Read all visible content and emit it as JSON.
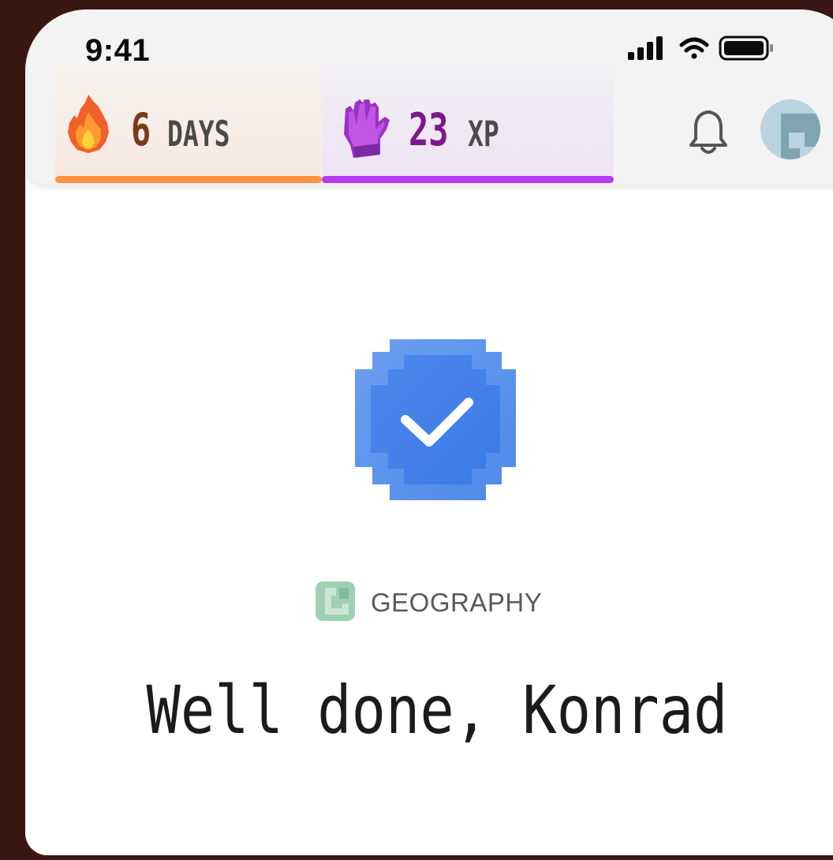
{
  "status_bar": {
    "time": "9:41",
    "icons": [
      "signal-icon",
      "wifi-icon",
      "battery-icon"
    ]
  },
  "header": {
    "streak": {
      "value": "6",
      "unit": "DAYS",
      "icon": "flame-icon",
      "color": "#ff9141"
    },
    "xp": {
      "value": "23",
      "unit": "XP",
      "icon": "glove-icon",
      "color": "#b53cf0"
    },
    "notifications_icon": "bell-icon",
    "avatar_icon": "avatar"
  },
  "main": {
    "badge_icon": "verified-check-badge-icon",
    "subject": {
      "label": "GEOGRAPHY",
      "icon": "geography-icon"
    },
    "title": "Well done, Konrad"
  },
  "colors": {
    "badge_blue": "#4a86ea",
    "subject_green": "#9fd0b4",
    "background": "#3a1712"
  }
}
